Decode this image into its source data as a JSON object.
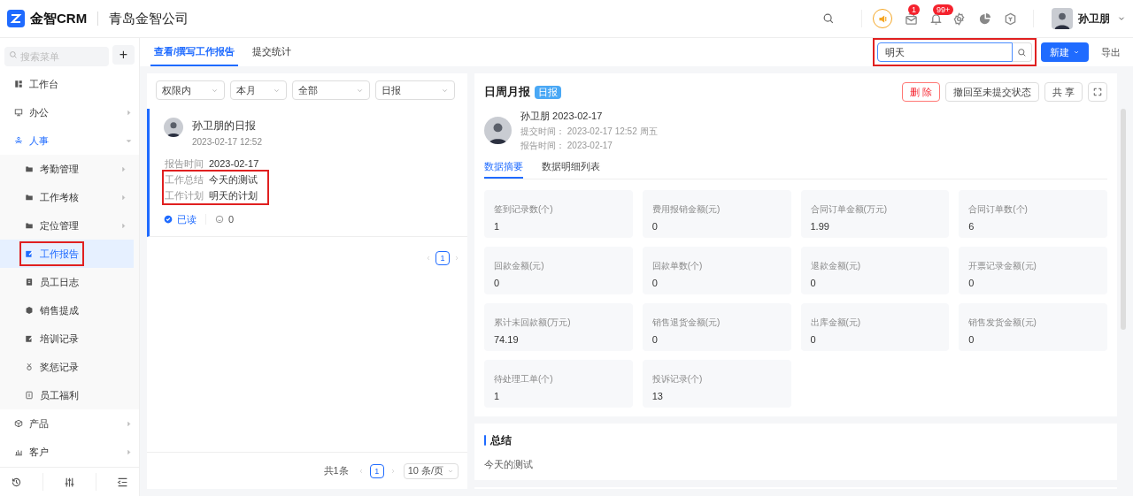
{
  "header": {
    "brand": "金智CRM",
    "company": "青岛金智公司",
    "notifications": [
      {
        "kind": "mail",
        "badge": "1"
      },
      {
        "kind": "bell",
        "badge": "99+"
      }
    ],
    "user": "孙卫朋"
  },
  "sidebar": {
    "search_placeholder": "搜索菜单",
    "add_label": "+",
    "items": [
      {
        "label": "工作台",
        "selected": false
      },
      {
        "label": "办公",
        "selected": false,
        "expanded": false
      },
      {
        "label": "人事",
        "selected": true,
        "expanded": true,
        "children": [
          {
            "label": "考勤管理",
            "selected": false,
            "has_submenu": true,
            "highlighted": false
          },
          {
            "label": "工作考核",
            "selected": false,
            "has_submenu": true,
            "highlighted": false
          },
          {
            "label": "定位管理",
            "selected": false,
            "has_submenu": true,
            "highlighted": false
          },
          {
            "label": "工作报告",
            "selected": true,
            "has_submenu": false,
            "highlighted": true
          },
          {
            "label": "员工日志",
            "selected": false,
            "has_submenu": false,
            "highlighted": false
          },
          {
            "label": "销售提成",
            "selected": false,
            "has_submenu": false,
            "highlighted": false
          },
          {
            "label": "培训记录",
            "selected": false,
            "has_submenu": false,
            "highlighted": false
          },
          {
            "label": "奖惩记录",
            "selected": false,
            "has_submenu": false,
            "highlighted": false
          },
          {
            "label": "员工福利",
            "selected": false,
            "has_submenu": false,
            "highlighted": false
          }
        ]
      },
      {
        "label": "产品",
        "selected": false,
        "expanded": false
      },
      {
        "label": "客户",
        "selected": false,
        "expanded": false
      }
    ]
  },
  "tabs": [
    {
      "label": "查看/撰写工作报告",
      "selected": true
    },
    {
      "label": "提交统计",
      "selected": false
    }
  ],
  "toolbar": {
    "search_value": "明天",
    "search_highlighted": true,
    "new_label": "新建",
    "export_label": "导出"
  },
  "filters": [
    "权限内",
    "本月",
    "全部",
    "日报"
  ],
  "reports": [
    {
      "title": "孙卫朋的日报",
      "time": "2023-02-17 12:52",
      "selected": true,
      "fields": [
        {
          "label": "报告时间",
          "value": "2023-02-17",
          "highlighted": false
        },
        {
          "label": "工作总结",
          "value": "今天的测试",
          "highlighted": true
        },
        {
          "label": "工作计划",
          "value": "明天的计划",
          "highlighted": true
        }
      ],
      "read": true,
      "read_label": "已读",
      "comments": "0"
    }
  ],
  "list_pagination": {
    "page": "1"
  },
  "footer_pagination": {
    "total": "共1条",
    "page": "1",
    "page_size": "10 条/页"
  },
  "detail": {
    "title": "日周月报",
    "badge": "日报",
    "actions": [
      {
        "label": "删 除",
        "kind": "danger"
      },
      {
        "label": "撤回至未提交状态",
        "kind": "default"
      },
      {
        "label": "共 享",
        "kind": "default"
      }
    ],
    "author_line": "孙卫朋 2023-02-17",
    "submit_time": "提交时间： 2023-02-17 12:52 周五",
    "report_time": "报告时间： 2023-02-17",
    "tabs": [
      {
        "label": "数据摘要",
        "selected": true
      },
      {
        "label": "数据明细列表",
        "selected": false
      }
    ],
    "stats": [
      {
        "label": "签到记录数(个)",
        "value": "1"
      },
      {
        "label": "费用报销金额(元)",
        "value": "0"
      },
      {
        "label": "合同订单金额(万元)",
        "value": "1.99"
      },
      {
        "label": "合同订单数(个)",
        "value": "6"
      },
      {
        "label": "回款金额(元)",
        "value": "0"
      },
      {
        "label": "回款单数(个)",
        "value": "0"
      },
      {
        "label": "退款金额(元)",
        "value": "0"
      },
      {
        "label": "开票记录金额(元)",
        "value": "0"
      },
      {
        "label": "累计未回款额(万元)",
        "value": "74.19"
      },
      {
        "label": "销售退货金额(元)",
        "value": "0"
      },
      {
        "label": "出库金额(元)",
        "value": "0"
      },
      {
        "label": "销售发货金额(元)",
        "value": "0"
      },
      {
        "label": "待处理工单(个)",
        "value": "1"
      },
      {
        "label": "投诉记录(个)",
        "value": "13"
      }
    ],
    "summary_title": "总结",
    "summary_text": "今天的测试"
  }
}
